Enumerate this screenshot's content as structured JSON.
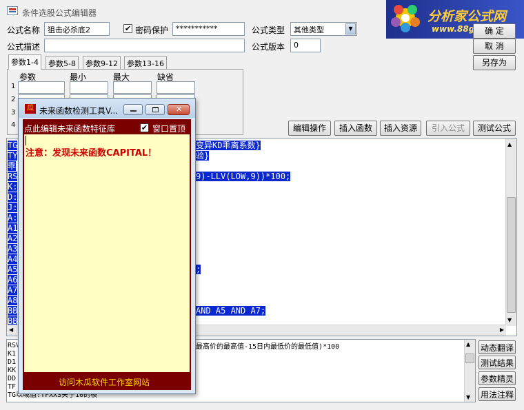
{
  "window": {
    "title": "条件选股公式编辑器"
  },
  "logo": {
    "text_cn": "分析家公式网",
    "url": "www.88gs.com"
  },
  "form": {
    "name_label": "公式名称",
    "name_value": "狙击必杀底2",
    "password_label": "密码保护",
    "password_checked": true,
    "password_value": "***********",
    "type_label": "公式类型",
    "type_value": "其他类型",
    "desc_label": "公式描述",
    "desc_value": "",
    "version_label": "公式版本",
    "version_value": "0"
  },
  "buttons": {
    "ok": "确  定",
    "cancel": "取  消",
    "save_as": "另存为",
    "edit_op": "编辑操作",
    "insert_func": "插入函数",
    "insert_res": "插入资源",
    "import_formula": "引入公式",
    "test_formula": "测试公式"
  },
  "tabs": [
    "参数1-4",
    "参数5-8",
    "参数9-12",
    "参数13-16"
  ],
  "params": {
    "headers": [
      "参数",
      "最小",
      "最大",
      "缺省"
    ],
    "rows": [
      "1",
      "2",
      "3",
      "4"
    ]
  },
  "editor": {
    "left_col": [
      "TG",
      "TY",
      "乖",
      "RS",
      "K:",
      "D:",
      "J:",
      "A:",
      "A1",
      "A2",
      "A3",
      "A4",
      "A5",
      "A6",
      "A7",
      "A8",
      "BB",
      "BB"
    ],
    "right_fragments": [
      {
        "line": 0,
        "text": "变异KD乖离系数}"
      },
      {
        "line": 1,
        "text": "验}"
      },
      {
        "line": 3,
        "text": "9)-LLV(LOW,9))*100;"
      },
      {
        "line": 12,
        "text": ";"
      },
      {
        "line": 16,
        "text": "AND A5 AND A7;"
      }
    ]
  },
  "bottom": {
    "lines": [
      "RSV",
      "K1",
      "D1",
      "KK",
      "DD",
      "TF",
      "TG以域值:TFXXS关于10的模"
    ],
    "right_text": "最高价的最高值-15日内最低价的最低值)*100"
  },
  "side_buttons": [
    "动态翻译",
    "测试结果",
    "参数精灵",
    "用法注释"
  ],
  "popup": {
    "title": "未来函数检测工具V...",
    "header_link": "点此编辑未来函数特征库",
    "pin_label": "窗口置顶",
    "pin_checked": true,
    "message": "注意：发现未来函数CAPITAL！",
    "footer_link": "访问木瓜软件工作室网站"
  }
}
